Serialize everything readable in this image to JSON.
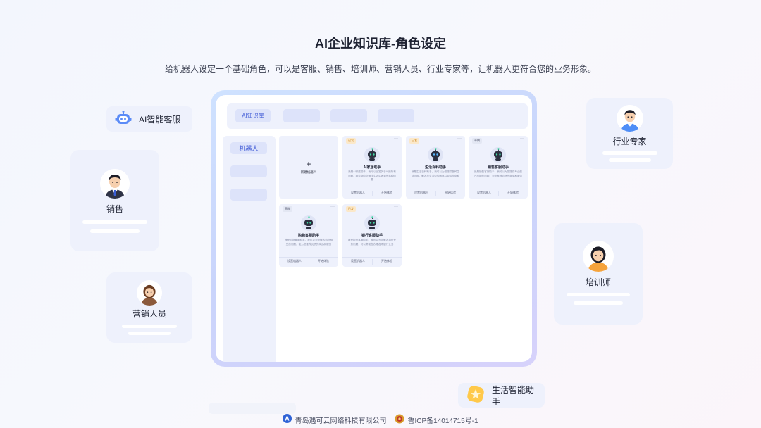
{
  "header": {
    "title": "AI企业知识库-角色设定",
    "subtitle": "给机器人设定一个基础角色，可以是客服、销售、培训师、营销人员、行业专家等，让机器人更符合您的业务形象。"
  },
  "chips": {
    "ai_service": "AI智能客服",
    "life_assistant": "生活智能助手"
  },
  "personas": {
    "sales": "销售",
    "marketing": "营销人员",
    "expert": "行业专家",
    "trainer": "培训师"
  },
  "app": {
    "tabs": [
      "AI知识库"
    ],
    "sidebar": [
      "机器人"
    ],
    "add_card_label": "新建机器人",
    "bots": [
      {
        "tag": "已发",
        "name": "AI家居助手",
        "desc": "我是AI家居助手，我可以回答关于AI的所有问题，我会帮助您解决生活中遇到的各种问题",
        "actions": [
          "设置机器人",
          "开始体验"
        ]
      },
      {
        "tag": "已发",
        "name": "生活百科助手",
        "desc": "我是生活百科助手，我可以为您提供各种生活问题，解答您生活中的困惑并带给您帮助",
        "actions": [
          "设置机器人",
          "开始体验"
        ]
      },
      {
        "tag": "草稿",
        "name": "销售客服助手",
        "desc": "我是销售客服助手，我可以为您提供专业的产品销售问题，为您推荐合适的商品和服务",
        "actions": [
          "设置机器人",
          "开始体验"
        ]
      },
      {
        "tag": "草稿",
        "name": "购物客服助手",
        "desc": "我是购物客服助手，我可以为您解答购物相关的问题，能为您推荐优质的商品和服务",
        "actions": [
          "设置机器人",
          "开始体验"
        ]
      },
      {
        "tag": "已发",
        "name": "银行客服助手",
        "desc": "我是银行客服助手，我可以为您解答银行业务问题，可以帮助您办理各项银行业务",
        "actions": [
          "设置机器人",
          "开始体验"
        ]
      }
    ]
  },
  "footer": {
    "company": "青岛遇可云网络科技有限公司",
    "icp": "鲁ICP备14014715号-1"
  },
  "colors": {
    "accent": "#4a63d8",
    "card_bg": "#eef1fc",
    "tag_bg": "#fbe8c9"
  }
}
